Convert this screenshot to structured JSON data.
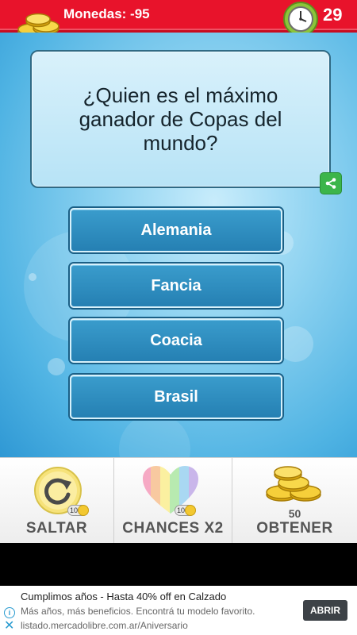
{
  "header": {
    "coins_label": "Monedas: -95",
    "timer_value": "29",
    "icons": [
      "coins-icon",
      "clock-icon"
    ],
    "bar_color": "#e8132b"
  },
  "question": {
    "text": "¿Quien es el máximo ganador de Copas del mundo?"
  },
  "answers": [
    {
      "label": "Alemania"
    },
    {
      "label": "Fancia"
    },
    {
      "label": "Coacia"
    },
    {
      "label": "Brasil"
    }
  ],
  "powerups": {
    "skip": {
      "label": "SALTAR",
      "cost": "10"
    },
    "chances": {
      "label": "CHANCES X2",
      "cost": "10"
    },
    "obtain": {
      "label": "OBTENER",
      "amount": "50"
    }
  },
  "ad": {
    "title": "Cumplimos años - Hasta 40% off en Calzado",
    "body": "Más años, más beneficios. Encontrá tu modelo favorito.",
    "url": "listado.mercadolibre.com.ar/Aniversario",
    "button_label": "ABRIR"
  }
}
